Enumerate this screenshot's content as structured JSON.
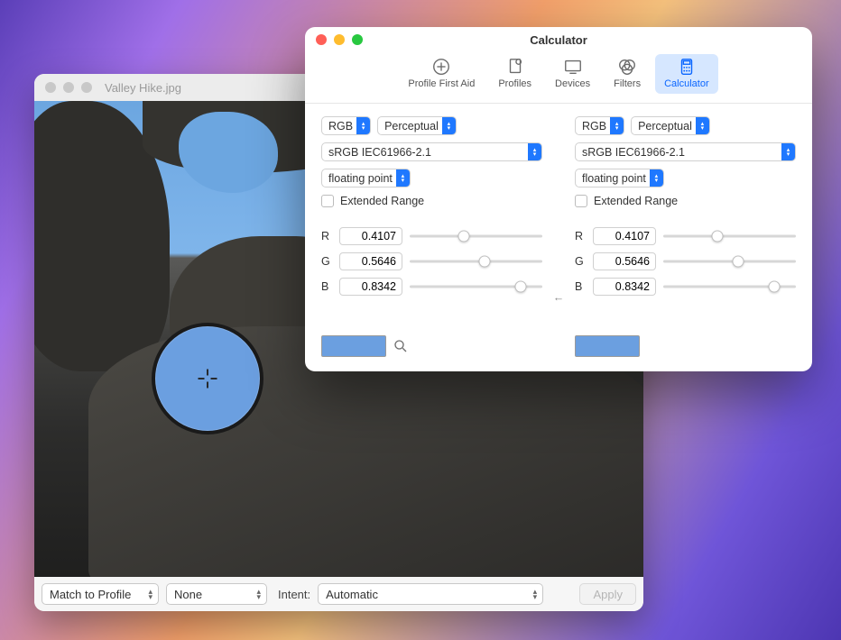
{
  "image_window": {
    "title": "Valley Hike.jpg",
    "footer": {
      "match_select": "Match to Profile",
      "profile_select": "None",
      "intent_label": "Intent:",
      "intent_select": "Automatic",
      "apply_label": "Apply"
    },
    "loupe_sample_color": "#6b9fe0"
  },
  "calc_window": {
    "title": "Calculator",
    "toolbar": [
      {
        "label": "Profile First Aid"
      },
      {
        "label": "Profiles"
      },
      {
        "label": "Devices"
      },
      {
        "label": "Filters"
      },
      {
        "label": "Calculator"
      }
    ],
    "active_tool_index": 4,
    "arrow_direction": "←",
    "left": {
      "color_model": "RGB",
      "rendering_intent": "Perceptual",
      "profile": "sRGB IEC61966-2.1",
      "number_format": "floating point",
      "extended_range_label": "Extended Range",
      "extended_range_checked": false,
      "channels": [
        {
          "id": "R",
          "label": "R",
          "value": "0.4107",
          "fraction": 0.4107
        },
        {
          "id": "G",
          "label": "G",
          "value": "0.5646",
          "fraction": 0.5646
        },
        {
          "id": "B",
          "label": "B",
          "value": "0.8342",
          "fraction": 0.8342
        }
      ],
      "swatch_color": "#6b9fe0"
    },
    "right": {
      "color_model": "RGB",
      "rendering_intent": "Perceptual",
      "profile": "sRGB IEC61966-2.1",
      "number_format": "floating point",
      "extended_range_label": "Extended Range",
      "extended_range_checked": false,
      "channels": [
        {
          "id": "R",
          "label": "R",
          "value": "0.4107",
          "fraction": 0.4107
        },
        {
          "id": "G",
          "label": "G",
          "value": "0.5646",
          "fraction": 0.5646
        },
        {
          "id": "B",
          "label": "B",
          "value": "0.8342",
          "fraction": 0.8342
        }
      ],
      "swatch_color": "#6b9fe0"
    }
  }
}
